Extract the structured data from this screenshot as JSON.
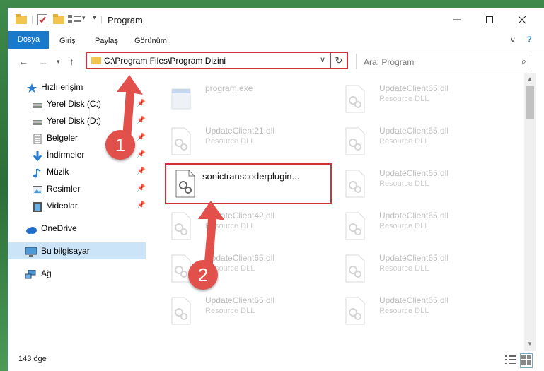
{
  "window": {
    "title": "Program"
  },
  "ribbon": {
    "tabs": [
      "Dosya",
      "Giriş",
      "Paylaş",
      "Görünüm"
    ]
  },
  "address": {
    "path": "C:\\Program Files\\Program Dizini"
  },
  "search": {
    "placeholder": "Ara: Program"
  },
  "sidebar": {
    "items": [
      {
        "label": "Hızlı erişim",
        "icon": "star-icon"
      },
      {
        "label": "Yerel Disk (C:)",
        "icon": "drive-icon",
        "pinned": true
      },
      {
        "label": "Yerel Disk (D:)",
        "icon": "drive-icon",
        "pinned": true
      },
      {
        "label": "Belgeler",
        "icon": "document-icon",
        "pinned": true
      },
      {
        "label": "İndirmeler",
        "icon": "download-icon",
        "pinned": true
      },
      {
        "label": "Müzik",
        "icon": "music-icon",
        "pinned": true
      },
      {
        "label": "Resimler",
        "icon": "pictures-icon",
        "pinned": true
      },
      {
        "label": "Videolar",
        "icon": "video-icon",
        "pinned": true
      },
      {
        "label": "OneDrive",
        "icon": "cloud-icon"
      },
      {
        "label": "Bu bilgisayar",
        "icon": "computer-icon",
        "selected": true
      },
      {
        "label": "Ağ",
        "icon": "network-icon"
      }
    ]
  },
  "files": [
    {
      "name": "program.exe",
      "type": ""
    },
    {
      "name": "UpdateClient65.dll",
      "type": "Resource DLL"
    },
    {
      "name": "UpdateClient21.dll",
      "type": "Resource DLL"
    },
    {
      "name": "UpdateClient65.dll",
      "type": "Resource DLL"
    },
    {
      "name": "sonictranscoderplugin...",
      "type": ""
    },
    {
      "name": "UpdateClient65.dll",
      "type": "Resource DLL"
    },
    {
      "name": "UpdateClient42.dll",
      "type": "Resource DLL"
    },
    {
      "name": "UpdateClient65.dll",
      "type": "Resource DLL"
    },
    {
      "name": "UpdateClient65.dll",
      "type": "Resource DLL"
    },
    {
      "name": "UpdateClient65.dll",
      "type": "Resource DLL"
    },
    {
      "name": "UpdateClient65.dll",
      "type": "Resource DLL"
    },
    {
      "name": "UpdateClient65.dll",
      "type": "Resource DLL"
    }
  ],
  "annotations": {
    "step1": "1",
    "step2": "2"
  },
  "status": {
    "count": "143 öge"
  },
  "colors": {
    "accent": "#1979ca",
    "highlight": "#d0343a",
    "badge": "#e2504c",
    "selected": "#cce4f7"
  }
}
